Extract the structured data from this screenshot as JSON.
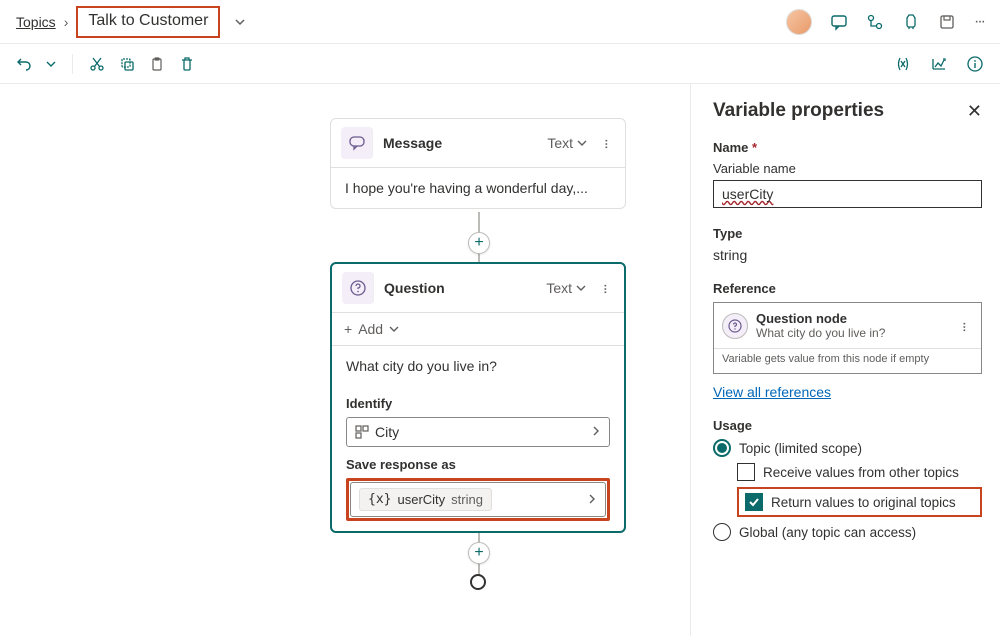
{
  "breadcrumb": {
    "root": "Topics",
    "current": "Talk to Customer"
  },
  "nodes": {
    "message": {
      "title": "Message",
      "type": "Text",
      "body": "I hope you're having a wonderful day,..."
    },
    "question": {
      "title": "Question",
      "type": "Text",
      "add_label": "Add",
      "prompt": "What city do you live in?",
      "identify_label": "Identify",
      "identify_value": "City",
      "save_label": "Save response as",
      "save_var": "userCity",
      "save_type": "string"
    }
  },
  "panel": {
    "title": "Variable properties",
    "name_label": "Name",
    "name_sub": "Variable name",
    "name_value": "userCity",
    "type_label": "Type",
    "type_value": "string",
    "ref_label": "Reference",
    "ref_node_title": "Question node",
    "ref_node_sub": "What city do you live in?",
    "ref_note": "Variable gets value from this node if empty",
    "view_refs": "View all references",
    "usage_label": "Usage",
    "usage_topic": "Topic (limited scope)",
    "usage_receive": "Receive values from other topics",
    "usage_return": "Return values to original topics",
    "usage_global": "Global (any topic can access)"
  }
}
